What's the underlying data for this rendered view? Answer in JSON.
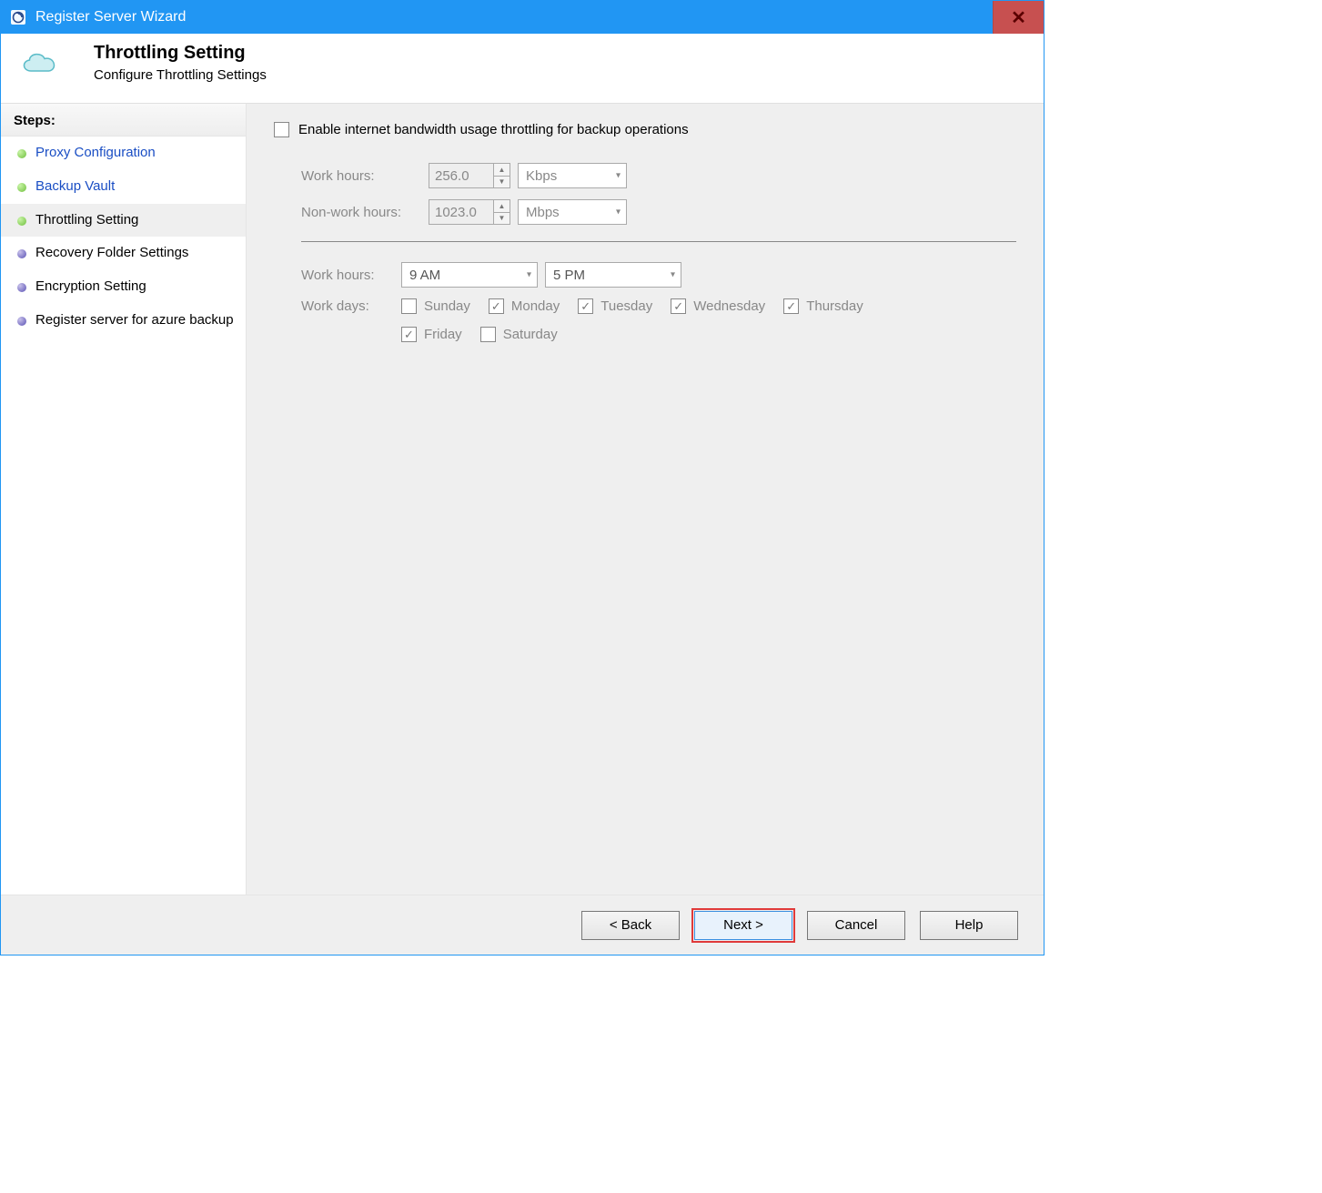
{
  "window": {
    "title": "Register Server Wizard",
    "close_symbol": "✕"
  },
  "header": {
    "title": "Throttling Setting",
    "subtitle": "Configure Throttling Settings"
  },
  "sidebar": {
    "header": "Steps:",
    "items": [
      {
        "label": "Proxy Configuration",
        "state": "done",
        "link": true
      },
      {
        "label": "Backup Vault",
        "state": "done",
        "link": true
      },
      {
        "label": "Throttling Setting",
        "state": "current",
        "link": false
      },
      {
        "label": "Recovery Folder Settings",
        "state": "pending",
        "link": false
      },
      {
        "label": "Encryption Setting",
        "state": "pending",
        "link": false
      },
      {
        "label": "Register server for azure backup",
        "state": "pending",
        "link": false
      }
    ]
  },
  "form": {
    "enable_label": "Enable internet bandwidth usage throttling for backup operations",
    "enable_checked": false,
    "work_hours_bw_label": "Work hours:",
    "work_hours_bw_value": "256.0",
    "work_hours_bw_unit": "Kbps",
    "nonwork_hours_bw_label": "Non-work hours:",
    "nonwork_hours_bw_value": "1023.0",
    "nonwork_hours_bw_unit": "Mbps",
    "work_hours_time_label": "Work hours:",
    "work_hours_start": "9 AM",
    "work_hours_end": "5 PM",
    "work_days_label": "Work days:",
    "days": [
      {
        "label": "Sunday",
        "checked": false
      },
      {
        "label": "Monday",
        "checked": true
      },
      {
        "label": "Tuesday",
        "checked": true
      },
      {
        "label": "Wednesday",
        "checked": true
      },
      {
        "label": "Thursday",
        "checked": true
      },
      {
        "label": "Friday",
        "checked": true
      },
      {
        "label": "Saturday",
        "checked": false
      }
    ]
  },
  "footer": {
    "back": "< Back",
    "next": "Next >",
    "cancel": "Cancel",
    "help": "Help"
  }
}
